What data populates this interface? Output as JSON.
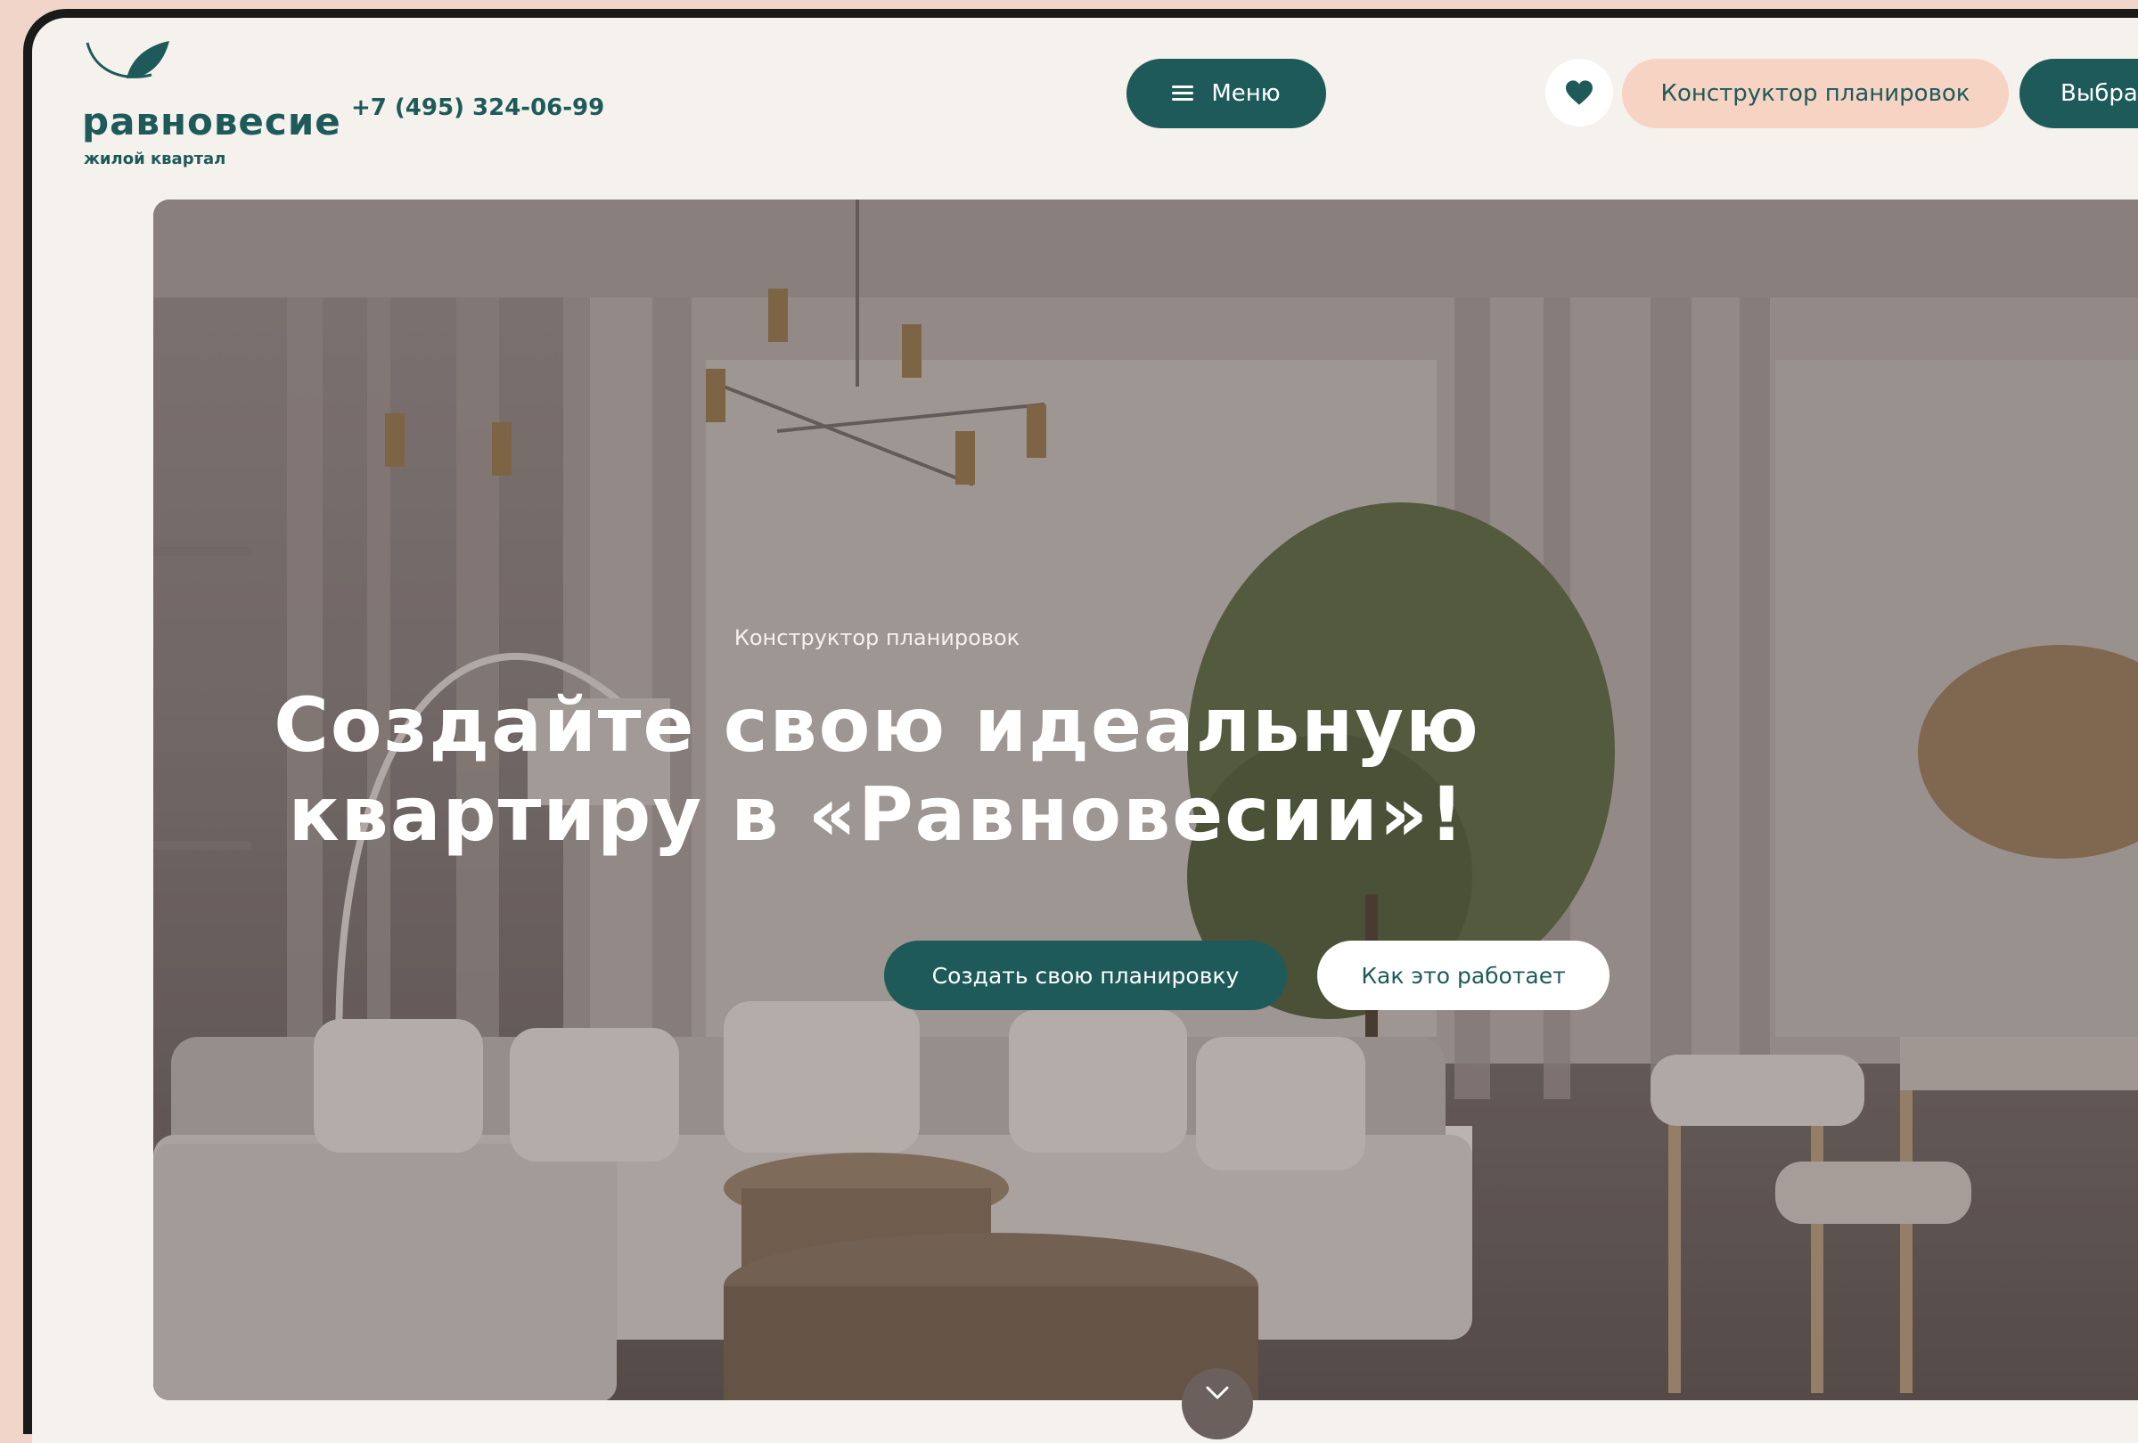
{
  "brand": {
    "name": "равновесие",
    "tagline": "жилой квартал",
    "colors": {
      "primary": "#1e5a5a",
      "accent": "#f7d3c4",
      "background": "#f5f1ed"
    }
  },
  "header": {
    "phone": "+7 (495) 324-06-99",
    "menu_label": "Меню",
    "menu_icon": "hamburger-icon",
    "favorites_icon": "heart-icon",
    "constructor_label": "Конструктор планировок",
    "choose_label": "Выбра"
  },
  "hero": {
    "kicker": "Конструктор планировок",
    "title_line1": "Создайте свою идеальную",
    "title_line2": "квартиру в «Равновесии»!",
    "primary_cta": "Создать свою планировку",
    "secondary_cta": "Как это работает",
    "scroll_icon": "chevron-down-icon"
  }
}
